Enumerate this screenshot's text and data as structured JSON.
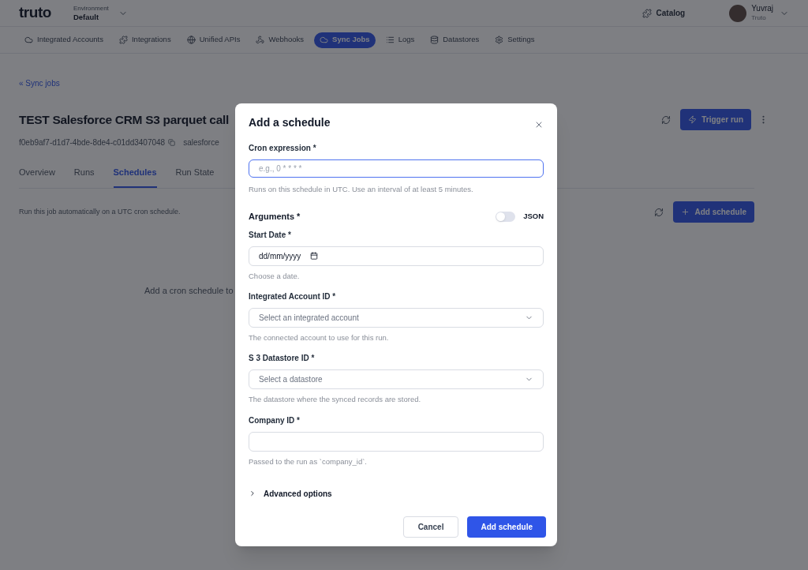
{
  "header": {
    "logo": "truto",
    "environment_label": "Environment",
    "environment": "Default",
    "catalog": "Catalog",
    "user": {
      "name": "Yuvraj",
      "org": "Truto"
    }
  },
  "nav": [
    {
      "label": "Integrated Accounts",
      "selected": false
    },
    {
      "label": "Integrations",
      "selected": false
    },
    {
      "label": "Unified APIs",
      "selected": false
    },
    {
      "label": "Webhooks",
      "selected": false
    },
    {
      "label": "Sync Jobs",
      "selected": true
    },
    {
      "label": "Logs",
      "selected": false
    },
    {
      "label": "Datastores",
      "selected": false
    },
    {
      "label": "Settings",
      "selected": false
    }
  ],
  "back_link": "« Sync jobs",
  "title": "TEST Salesforce CRM S3 parquet call",
  "job_id": "f0eb9af7-d1d7-4bde-8de4-c01dd3407048",
  "integration": "salesforce",
  "trigger_button": "Trigger run",
  "tabs": [
    {
      "label": "Overview",
      "selected": false
    },
    {
      "label": "Runs",
      "selected": false
    },
    {
      "label": "Schedules",
      "selected": true
    },
    {
      "label": "Run State",
      "selected": false
    }
  ],
  "schedules_description": "Run this job automatically on a UTC cron schedule.",
  "add_schedule_button": "Add schedule",
  "empty_text": "Add a cron schedule to",
  "dialog": {
    "title": "Add a schedule",
    "cron": {
      "label": "Cron expression *",
      "placeholder": "e.g., 0 * * * *",
      "help": "Runs on this schedule in UTC. Use an interval of at least 5 minutes."
    },
    "arguments_label": "Arguments *",
    "json_toggle": {
      "label": "JSON",
      "on": false
    },
    "fields": [
      {
        "kind": "date",
        "label": "Start Date *",
        "value": "dd/mm/yyyy",
        "help": "Choose a date."
      },
      {
        "kind": "select",
        "label": "Integrated Account ID *",
        "placeholder": "Select an integrated account",
        "help": "The connected account to use for this run."
      },
      {
        "kind": "select",
        "label": "S 3 Datastore ID *",
        "placeholder": "Select a datastore",
        "help": "The datastore where the synced records are stored."
      },
      {
        "kind": "text",
        "label": "Company ID *",
        "help": "Passed to the run as `company_id`."
      }
    ],
    "advanced": {
      "label": "Advanced options",
      "expanded": false
    },
    "cancel": "Cancel",
    "submit": "Add schedule"
  }
}
